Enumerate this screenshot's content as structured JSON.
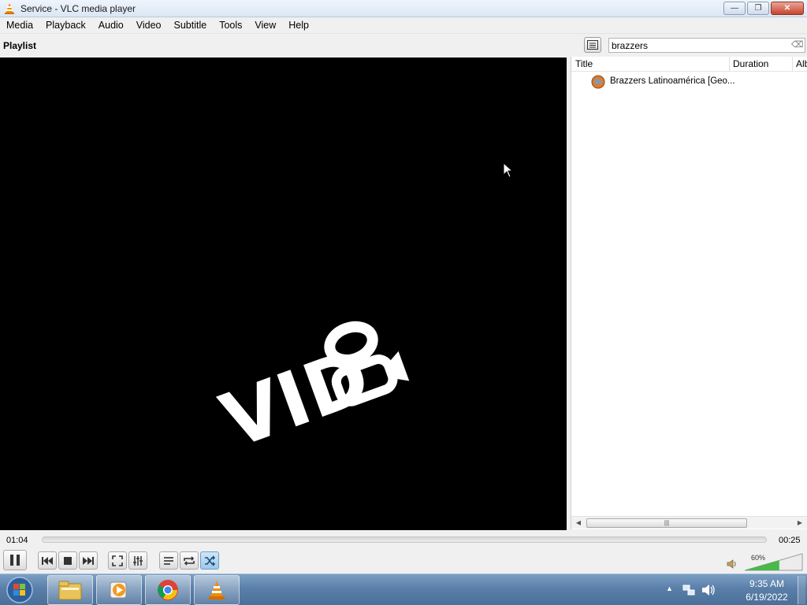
{
  "window": {
    "title": "Service - VLC media player",
    "buttons": {
      "minimize": "—",
      "restore": "❐",
      "close": "✕"
    }
  },
  "menu": [
    "Media",
    "Playback",
    "Audio",
    "Video",
    "Subtitle",
    "Tools",
    "View",
    "Help"
  ],
  "playlist": {
    "label": "Playlist",
    "search_value": "brazzers",
    "columns": {
      "title": "Title",
      "duration": "Duration",
      "album": "Alb"
    },
    "items": [
      {
        "title": "Brazzers Latinoamérica [Geo..."
      }
    ]
  },
  "video": {
    "logo_text": "VIDeo"
  },
  "player": {
    "elapsed": "01:04",
    "remaining": "00:25",
    "progress": 0.0,
    "volume_label": "60%",
    "volume": 0.6
  },
  "clock": {
    "time": "9:35 AM",
    "date": "6/19/2022"
  },
  "colors": {
    "vlc_orange": "#f28c00",
    "accent": "#2a7fd4"
  }
}
